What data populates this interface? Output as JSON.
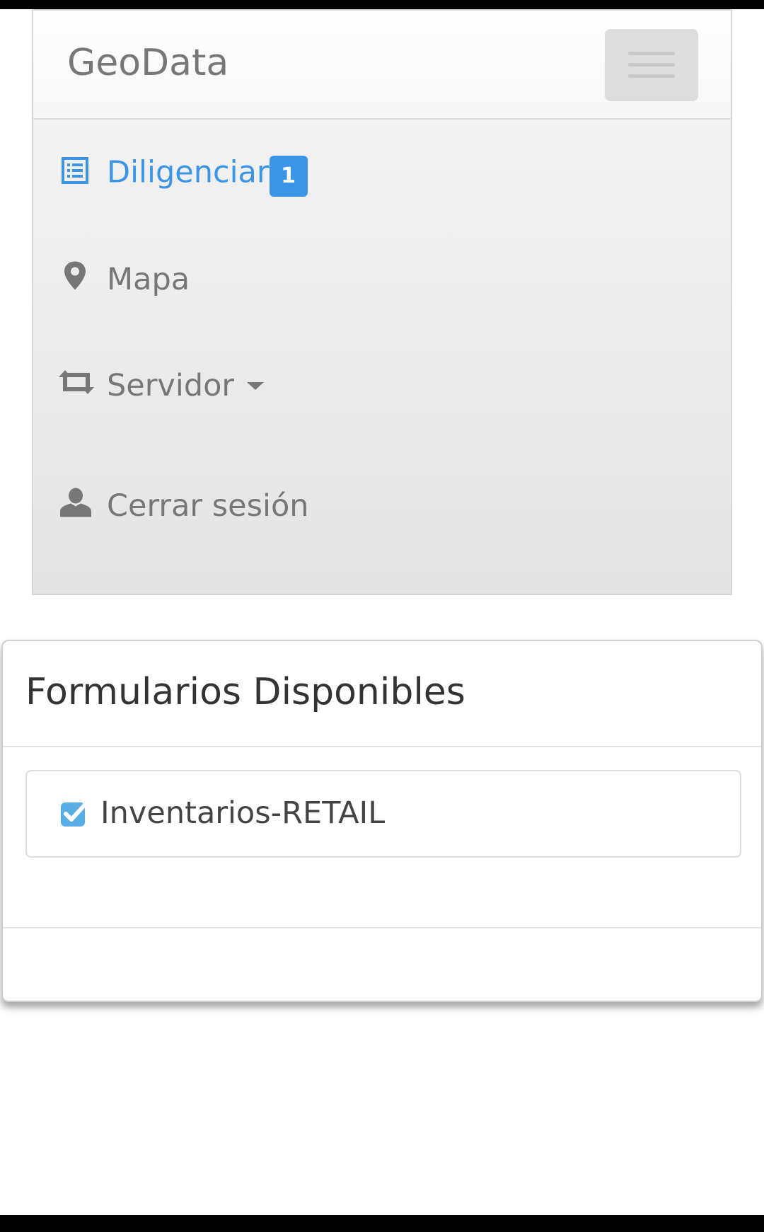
{
  "navbar": {
    "brand": "GeoData",
    "toggle_icon": "hamburger-menu-icon",
    "items": [
      {
        "label": "Diligenciar",
        "icon": "list-icon",
        "badge": "1",
        "active": true
      },
      {
        "label": "Mapa",
        "icon": "map-marker-icon"
      },
      {
        "label": "Servidor",
        "icon": "retweet-icon",
        "dropdown": true
      },
      {
        "label": "Cerrar sesión",
        "icon": "user-icon"
      }
    ]
  },
  "panel": {
    "title": "Formularios Disponibles",
    "forms": [
      {
        "label": "Inventarios-RETAIL",
        "icon": "check-square-icon"
      }
    ]
  },
  "colors": {
    "accent": "#3a95e8",
    "nav_text": "#777777",
    "title_text": "#333333"
  }
}
